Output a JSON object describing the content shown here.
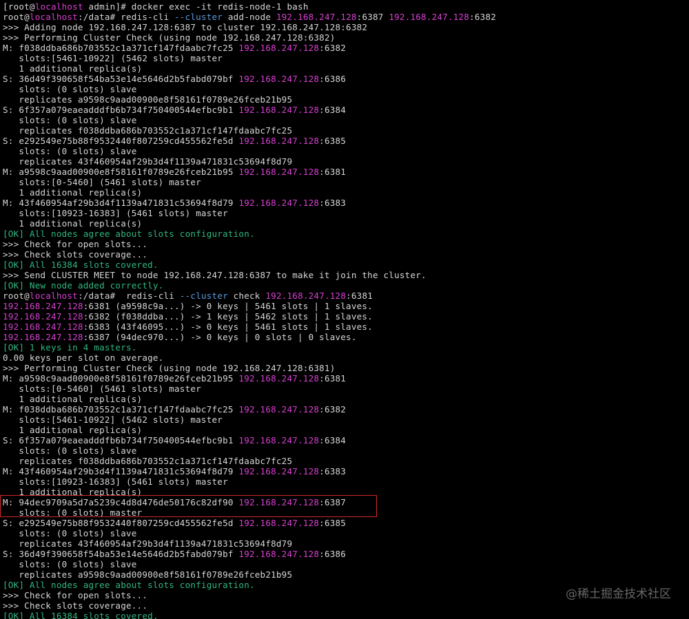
{
  "terminal": {
    "lines": [
      [
        {
          "t": "[root@",
          "c": "d"
        },
        {
          "t": "localhost",
          "c": "m"
        },
        {
          "t": " admin]# docker exec -it redis-node-1 bash",
          "c": "d"
        }
      ],
      [
        {
          "t": "root@",
          "c": "d"
        },
        {
          "t": "localhost",
          "c": "m"
        },
        {
          "t": ":/data# redis-cli ",
          "c": "d"
        },
        {
          "t": "--cluster",
          "c": "b"
        },
        {
          "t": " add-node ",
          "c": "d"
        },
        {
          "t": "192.168.247.128",
          "c": "m"
        },
        {
          "t": ":6387 ",
          "c": "d"
        },
        {
          "t": "192.168.247.128",
          "c": "m"
        },
        {
          "t": ":6382",
          "c": "d"
        }
      ],
      [
        {
          "t": ">>> Adding node 192.168.247.128:6387 to cluster 192.168.247.128:6382",
          "c": "d"
        }
      ],
      [
        {
          "t": ">>> Performing Cluster Check (using node 192.168.247.128:6382)",
          "c": "d"
        }
      ],
      [
        {
          "t": "M: f038ddba686b703552c1a371cf147fdaabc7fc25 ",
          "c": "d"
        },
        {
          "t": "192.168.247.128",
          "c": "m"
        },
        {
          "t": ":6382",
          "c": "d"
        }
      ],
      [
        {
          "t": "   slots:[5461-10922] (5462 slots) master",
          "c": "d"
        }
      ],
      [
        {
          "t": "   1 additional replica(s)",
          "c": "d"
        }
      ],
      [
        {
          "t": "S: 36d49f390658f54ba53e14e5646d2b5fabd079bf ",
          "c": "d"
        },
        {
          "t": "192.168.247.128",
          "c": "m"
        },
        {
          "t": ":6386",
          "c": "d"
        }
      ],
      [
        {
          "t": "   slots: (0 slots) slave",
          "c": "d"
        }
      ],
      [
        {
          "t": "   replicates a9598c9aad00900e8f58161f0789e26fceb21b95",
          "c": "d"
        }
      ],
      [
        {
          "t": "S: 6f357a079eaeadddfb6b734f750400544efbc9b1 ",
          "c": "d"
        },
        {
          "t": "192.168.247.128",
          "c": "m"
        },
        {
          "t": ":6384",
          "c": "d"
        }
      ],
      [
        {
          "t": "   slots: (0 slots) slave",
          "c": "d"
        }
      ],
      [
        {
          "t": "   replicates f038ddba686b703552c1a371cf147fdaabc7fc25",
          "c": "d"
        }
      ],
      [
        {
          "t": "S: e292549e75b88f9532440f807259cd455562fe5d ",
          "c": "d"
        },
        {
          "t": "192.168.247.128",
          "c": "m"
        },
        {
          "t": ":6385",
          "c": "d"
        }
      ],
      [
        {
          "t": "   slots: (0 slots) slave",
          "c": "d"
        }
      ],
      [
        {
          "t": "   replicates 43f460954af29b3d4f1139a471831c53694f8d79",
          "c": "d"
        }
      ],
      [
        {
          "t": "M: a9598c9aad00900e8f58161f0789e26fceb21b95 ",
          "c": "d"
        },
        {
          "t": "192.168.247.128",
          "c": "m"
        },
        {
          "t": ":6381",
          "c": "d"
        }
      ],
      [
        {
          "t": "   slots:[0-5460] (5461 slots) master",
          "c": "d"
        }
      ],
      [
        {
          "t": "   1 additional replica(s)",
          "c": "d"
        }
      ],
      [
        {
          "t": "M: 43f460954af29b3d4f1139a471831c53694f8d79 ",
          "c": "d"
        },
        {
          "t": "192.168.247.128",
          "c": "m"
        },
        {
          "t": ":6383",
          "c": "d"
        }
      ],
      [
        {
          "t": "   slots:[10923-16383] (5461 slots) master",
          "c": "d"
        }
      ],
      [
        {
          "t": "   1 additional replica(s)",
          "c": "d"
        }
      ],
      [
        {
          "t": "[OK] All nodes agree about slots configuration.",
          "c": "g"
        }
      ],
      [
        {
          "t": ">>> Check for open slots...",
          "c": "d"
        }
      ],
      [
        {
          "t": ">>> Check slots coverage...",
          "c": "d"
        }
      ],
      [
        {
          "t": "[OK] All 16384 slots covered.",
          "c": "g"
        }
      ],
      [
        {
          "t": ">>> Send CLUSTER MEET to node 192.168.247.128:6387 to make it join the cluster.",
          "c": "d"
        }
      ],
      [
        {
          "t": "[OK] New node added correctly.",
          "c": "g"
        }
      ],
      [
        {
          "t": "root@",
          "c": "d"
        },
        {
          "t": "localhost",
          "c": "m"
        },
        {
          "t": ":/data#  redis-cli ",
          "c": "d"
        },
        {
          "t": "--cluster",
          "c": "b"
        },
        {
          "t": " check ",
          "c": "d"
        },
        {
          "t": "192.168.247.128",
          "c": "m"
        },
        {
          "t": ":6381",
          "c": "d"
        }
      ],
      [
        {
          "t": "192.168.247.128",
          "c": "m"
        },
        {
          "t": ":6381 (a9598c9a...) -> 0 keys | 5461 slots | 1 slaves.",
          "c": "d"
        }
      ],
      [
        {
          "t": "192.168.247.128",
          "c": "m"
        },
        {
          "t": ":6382 (f038ddba...) -> 1 keys | 5462 slots | 1 slaves.",
          "c": "d"
        }
      ],
      [
        {
          "t": "192.168.247.128",
          "c": "m"
        },
        {
          "t": ":6383 (43f46095...) -> 0 keys | 5461 slots | 1 slaves.",
          "c": "d"
        }
      ],
      [
        {
          "t": "192.168.247.128",
          "c": "m"
        },
        {
          "t": ":6387 (94dec970...) -> 0 keys | 0 slots | 0 slaves.",
          "c": "d"
        }
      ],
      [
        {
          "t": "[OK] 1 keys in 4 masters.",
          "c": "g"
        }
      ],
      [
        {
          "t": "0.00 keys per slot on average.",
          "c": "d"
        }
      ],
      [
        {
          "t": ">>> Performing Cluster Check (using node 192.168.247.128:6381)",
          "c": "d"
        }
      ],
      [
        {
          "t": "M: a9598c9aad00900e8f58161f0789e26fceb21b95 ",
          "c": "d"
        },
        {
          "t": "192.168.247.128",
          "c": "m"
        },
        {
          "t": ":6381",
          "c": "d"
        }
      ],
      [
        {
          "t": "   slots:[0-5460] (5461 slots) master",
          "c": "d"
        }
      ],
      [
        {
          "t": "   1 additional replica(s)",
          "c": "d"
        }
      ],
      [
        {
          "t": "M: f038ddba686b703552c1a371cf147fdaabc7fc25 ",
          "c": "d"
        },
        {
          "t": "192.168.247.128",
          "c": "m"
        },
        {
          "t": ":6382",
          "c": "d"
        }
      ],
      [
        {
          "t": "   slots:[5461-10922] (5462 slots) master",
          "c": "d"
        }
      ],
      [
        {
          "t": "   1 additional replica(s)",
          "c": "d"
        }
      ],
      [
        {
          "t": "S: 6f357a079eaeadddfb6b734f750400544efbc9b1 ",
          "c": "d"
        },
        {
          "t": "192.168.247.128",
          "c": "m"
        },
        {
          "t": ":6384",
          "c": "d"
        }
      ],
      [
        {
          "t": "   slots: (0 slots) slave",
          "c": "d"
        }
      ],
      [
        {
          "t": "   replicates f038ddba686b703552c1a371cf147fdaabc7fc25",
          "c": "d"
        }
      ],
      [
        {
          "t": "M: 43f460954af29b3d4f1139a471831c53694f8d79 ",
          "c": "d"
        },
        {
          "t": "192.168.247.128",
          "c": "m"
        },
        {
          "t": ":6383",
          "c": "d"
        }
      ],
      [
        {
          "t": "   slots:[10923-16383] (5461 slots) master",
          "c": "d"
        }
      ],
      [
        {
          "t": "   1 additional replica(s)",
          "c": "d"
        }
      ],
      [
        {
          "t": "M: 94dec9709a5d7a5239c4d8d476de50176c82df90 ",
          "c": "d"
        },
        {
          "t": "192.168.247.128",
          "c": "m"
        },
        {
          "t": ":6387",
          "c": "d"
        }
      ],
      [
        {
          "t": "   slots: (0 slots) master",
          "c": "d"
        }
      ],
      [
        {
          "t": "S: e292549e75b88f9532440f807259cd455562fe5d ",
          "c": "d"
        },
        {
          "t": "192.168.247.128",
          "c": "m"
        },
        {
          "t": ":6385",
          "c": "d"
        }
      ],
      [
        {
          "t": "   slots: (0 slots) slave",
          "c": "d"
        }
      ],
      [
        {
          "t": "   replicates 43f460954af29b3d4f1139a471831c53694f8d79",
          "c": "d"
        }
      ],
      [
        {
          "t": "S: 36d49f390658f54ba53e14e5646d2b5fabd079bf ",
          "c": "d"
        },
        {
          "t": "192.168.247.128",
          "c": "m"
        },
        {
          "t": ":6386",
          "c": "d"
        }
      ],
      [
        {
          "t": "   slots: (0 slots) slave",
          "c": "d"
        }
      ],
      [
        {
          "t": "   replicates a9598c9aad00900e8f58161f0789e26fceb21b95",
          "c": "d"
        }
      ],
      [
        {
          "t": "[OK] All nodes agree about slots configuration.",
          "c": "g"
        }
      ],
      [
        {
          "t": ">>> Check for open slots...",
          "c": "d"
        }
      ],
      [
        {
          "t": ">>> Check slots coverage...",
          "c": "d"
        }
      ],
      [
        {
          "t": "[OK] All 16384 slots covered.",
          "c": "g"
        }
      ]
    ]
  },
  "watermark": "@稀土掘金技术社区",
  "colors": {
    "background": "#000000",
    "text": "#d6d6d6",
    "ip_magenta": "#d93fd2",
    "ok_green": "#31b780",
    "option_blue": "#5a9bdc",
    "highlight_red": "#d02a2a"
  }
}
